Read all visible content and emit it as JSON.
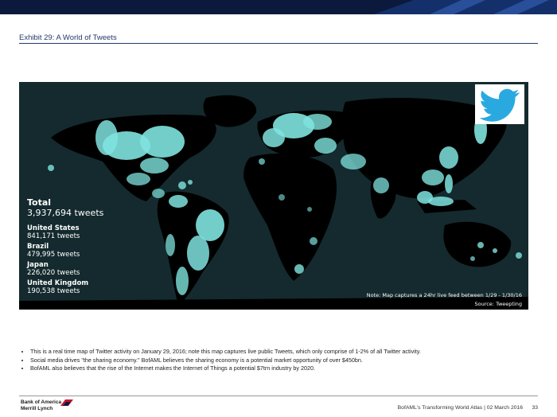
{
  "header": {
    "exhibit_title": "Exhibit 29: A World of Tweets"
  },
  "map": {
    "stats": {
      "total_label": "Total",
      "total_value": "3,937,694 tweets",
      "countries": [
        {
          "name": "United States",
          "value": "841,171 tweets"
        },
        {
          "name": "Brazil",
          "value": "479,995 tweets"
        },
        {
          "name": "Japan",
          "value": "226,020 tweets"
        },
        {
          "name": "United Kingdom",
          "value": "190,538 tweets"
        }
      ]
    },
    "note": "Note: Map captures a 24hr live feed between 1/29 - 1/30/16",
    "source": "Source: Tweepting",
    "logo_icon": "twitter-bird-icon",
    "colors": {
      "background": "#142a2e",
      "land": "#000000",
      "tweets": "#7fe3df",
      "logo_blue": "#2aa9e0"
    }
  },
  "bullets": [
    "This is a real time map of Twitter activity on January 29, 2016; note this map captures live public Tweets, which only comprise of 1-2% of all Twitter activity.",
    "Social media drives \"the sharing economy.\" BofAML believes the sharing economy is a potential market opportunity of over $450bn.",
    "BofAML also believes that the rise of the Internet makes the Internet of Things a potential $7trn industry by 2020."
  ],
  "footer": {
    "logo_line1": "Bank of America",
    "logo_line2": "Merrill Lynch",
    "report_title": "BofAML's Transforming World Atlas",
    "date": "| 02 March 2016",
    "page": "33"
  }
}
